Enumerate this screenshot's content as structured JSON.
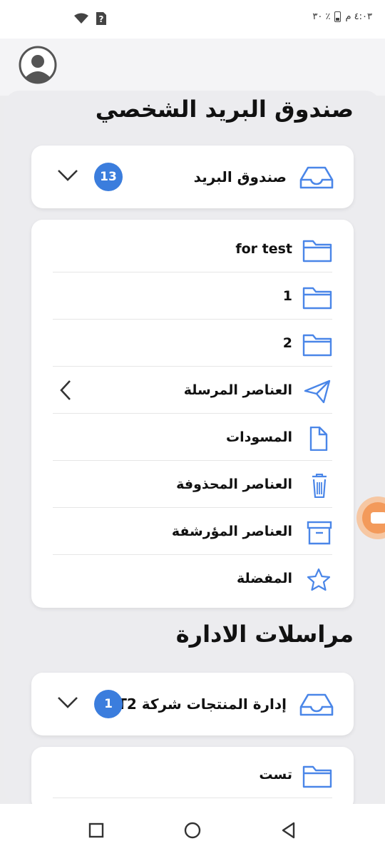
{
  "status_bar": {
    "time": "٤:٠٣ م",
    "battery_percent": "٣٠ ٪",
    "wifi_icon": "wifi-icon",
    "sim_icon": "sim-unknown-icon"
  },
  "header": {
    "avatar_icon": "user-avatar-icon"
  },
  "personal_section": {
    "title": "صندوق البريد الشخصي",
    "mailbox": {
      "label": "صندوق البريد",
      "badge": "13",
      "icon": "inbox-tray-icon"
    },
    "folders": [
      {
        "label": "for test",
        "icon": "folder-icon"
      },
      {
        "label": "1",
        "icon": "folder-icon"
      },
      {
        "label": "2",
        "icon": "folder-icon"
      },
      {
        "label": "العناصر المرسلة",
        "icon": "send-icon",
        "has_chevron": true
      },
      {
        "label": "المسودات",
        "icon": "draft-file-icon"
      },
      {
        "label": "العناصر المحذوفة",
        "icon": "trash-icon"
      },
      {
        "label": "العناصر المؤرشفة",
        "icon": "archive-icon"
      },
      {
        "label": "المفضلة",
        "icon": "star-icon"
      }
    ]
  },
  "admin_section": {
    "title": "مراسلات الادارة",
    "mailbox": {
      "label": "إدارة المنتجات شركة T2",
      "badge": "1",
      "icon": "inbox-tray-icon"
    },
    "folders": [
      {
        "label": "تست",
        "icon": "folder-icon"
      }
    ]
  },
  "colors": {
    "accent": "#3b7ddd",
    "icon_blue": "#4a86e8",
    "floating": "#f39a5b"
  }
}
